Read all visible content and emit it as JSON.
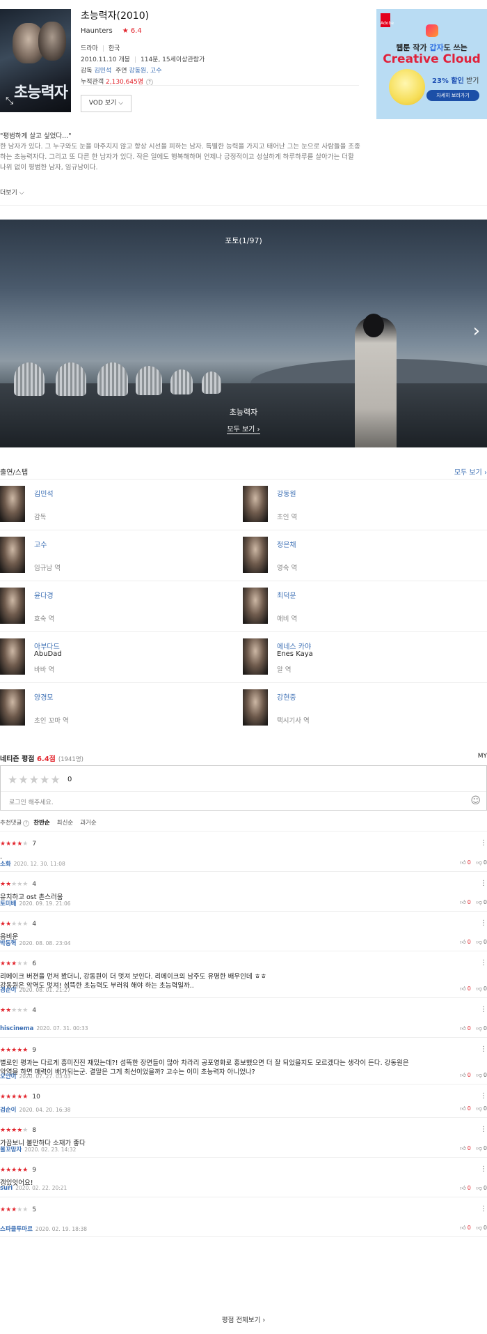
{
  "movie": {
    "title": "초능력자(2010)",
    "en_title": "Haunters",
    "rating": "★ 6.4",
    "genre": "드라마",
    "country": "한국",
    "release": "2010.11.10 개봉",
    "runtime_grade": "114분, 15세이상관람가",
    "director_label": "감독",
    "director": "김민석",
    "cast_label": "주연",
    "leads": "강동원, 고수",
    "audience_label": "누적관객",
    "audience": "2,130,645명",
    "help": "?",
    "vod_button": "VOD 보기",
    "poster_title": "초능력자",
    "expand_icon": "⤡"
  },
  "ad": {
    "brand": "Adobe",
    "line1_pre": "웹툰 작가 ",
    "line1_hl": "갑자",
    "line1_post": "도 쓰는",
    "line2": "Creative Cloud",
    "discount": "23% 할인",
    "discount_post": " 받기",
    "button": "자세히 보러가기"
  },
  "synopsis": {
    "quote": "\"평범하게 살고 싶었다...\"",
    "body": "한 남자가 있다. 그 누구와도 눈을 마주치지 않고 항상 시선을 피하는 남자. 특별한 능력을 가지고 태어난 그는 눈으로 사람들을 조종하는 초능력자다. 그리고 또 다른 한 남자가 있다. 작은 일에도 행복해하며 언제나 긍정적이고 성실하게 하루하루를 살아가는 더할 나위 없이 평범한 남자, 임규남이다.",
    "more": "더보기 ⌵"
  },
  "photo": {
    "title": "포토(1/97)",
    "caption": "초능력자",
    "more": "모두 보기 ›",
    "next": "›"
  },
  "cast": {
    "title": "출연/스탭",
    "all": "모두 보기 ›",
    "people": [
      {
        "name": "김민석",
        "en": "",
        "role": "감독"
      },
      {
        "name": "강동원",
        "en": "",
        "role": "초인 역"
      },
      {
        "name": "고수",
        "en": "",
        "role": "임규남 역"
      },
      {
        "name": "정은채",
        "en": "",
        "role": "영숙 역"
      },
      {
        "name": "윤다경",
        "en": "",
        "role": "효숙 역"
      },
      {
        "name": "최덕문",
        "en": "",
        "role": "애비 역"
      },
      {
        "name": "아부다드",
        "en": "AbuDad",
        "role": "바바 역"
      },
      {
        "name": "에네스 카야",
        "en": "Enes Kaya",
        "role": "알 역"
      },
      {
        "name": "양경모",
        "en": "",
        "role": "초인 꼬마 역"
      },
      {
        "name": "강현중",
        "en": "",
        "role": "택시기사 역"
      }
    ]
  },
  "netizen": {
    "title": "네티즌 평점 ",
    "score": "6.4점",
    "count": "(1941명)",
    "my": "MY",
    "empty_stars": "★★★★★",
    "zero": "0",
    "placeholder": "로그인 해주세요.",
    "smile": "☺",
    "sort_label": "추천댓글",
    "sort_q": "?",
    "sort_1": "찬반순",
    "sort_2": "최신순",
    "sort_3": "과거순",
    "all_reviews": "평점 전체보기 ›"
  },
  "comments": [
    {
      "on": "★★★★",
      "off": "★",
      "score": "7",
      "text": ".",
      "user": "소화",
      "date": "2020. 12. 30. 11:08",
      "up": "0",
      "down": "0"
    },
    {
      "on": "★★",
      "off": "★★★",
      "score": "4",
      "text": "유치하고 ost 촌스러움",
      "user": "토미배",
      "date": "2020. 09. 19. 21:06",
      "up": "0",
      "down": "0"
    },
    {
      "on": "★★",
      "off": "★★★",
      "score": "4",
      "text": "음비운",
      "user": "박동혁",
      "date": "2020. 08. 08. 23:04",
      "up": "0",
      "down": "0"
    },
    {
      "on": "★★★",
      "off": "★★",
      "score": "6",
      "text": "리메이크 버젼을 먼저 봤더니, 강동원이 더 멋져 보인다. 리메이크의 남주도 유명한 배우인데 ㅎㅎ\n강동원은 악역도 멋져! 섬뜩한 초능력도 부러워 해야 하는 초능력일까..",
      "user": "경순이",
      "date": "2020. 08. 01. 21:27",
      "up": "0",
      "down": "0"
    },
    {
      "on": "★★",
      "off": "★★★",
      "score": "4",
      "text": "",
      "user": "hiscinema",
      "date": "2020. 07. 31. 00:33",
      "up": "0",
      "down": "0"
    },
    {
      "on": "★★★★★",
      "off": "",
      "score": "9",
      "text": "별로인 평과는 다르게 흥미진진 재밌는데?! 섬뜩한 장면들이 많아 차라리 공포영화로 홍보했으면 더 잘 되었을지도 모르겠다는 생각이 든다. 강동원은 악역을 하면 매력이 배가되는군. 결말은 그게 최선이었을까? 고수는 이미 초능력자 아니었나?",
      "user": "오얀이",
      "date": "2020. 07. 27. 03:03",
      "up": "0",
      "down": "0"
    },
    {
      "on": "★★★★★",
      "off": "",
      "score": "10",
      "text": "",
      "user": "검순이",
      "date": "2020. 04. 20. 16:38",
      "up": "0",
      "down": "0"
    },
    {
      "on": "★★★★",
      "off": "★",
      "score": "8",
      "text": "가끔보니 볼만하다  소재가  좋다",
      "user": "볼꼬맘자",
      "date": "2020. 02. 23. 14:32",
      "up": "0",
      "down": "0"
    },
    {
      "on": "★★★★★",
      "off": "",
      "score": "9",
      "text": "갱있엇어요!",
      "user": "suri",
      "date": "2020. 02. 22. 20:21",
      "up": "0",
      "down": "0"
    },
    {
      "on": "★★★",
      "off": "★★",
      "score": "5",
      "text": "",
      "user": "스파클투마르",
      "date": "2020. 02. 19. 18:38",
      "up": "0",
      "down": "0"
    }
  ],
  "colors": {
    "accent": "#e2242c",
    "link": "#3c6fb4"
  },
  "icons": {
    "thumb_up": "thumb-up-icon",
    "thumb_down": "thumb-down-icon",
    "more": "more-dots-icon"
  }
}
